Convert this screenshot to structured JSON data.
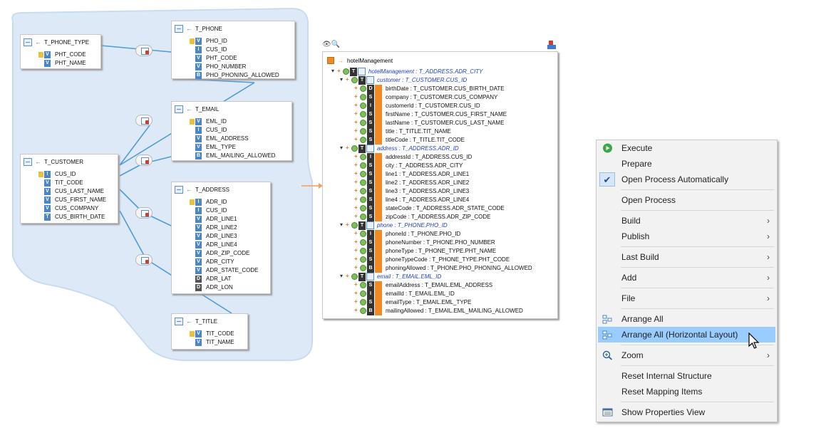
{
  "colors": {
    "diagram_background": "#dde9f7",
    "connector": "#4f9bd6",
    "mapping_arrow": "#f0a060",
    "menu_selection": "#99ccff",
    "menu_background": "#f2f2f2"
  },
  "tables": [
    {
      "name": "T_PHONE_TYPE",
      "columns": [
        {
          "name": "PHT_CODE",
          "type": "V",
          "key": true
        },
        {
          "name": "PHT_NAME",
          "type": "V",
          "key": false
        }
      ]
    },
    {
      "name": "T_PHONE",
      "columns": [
        {
          "name": "PHO_ID",
          "type": "V",
          "key": true
        },
        {
          "name": "CUS_ID",
          "type": "I",
          "key": false
        },
        {
          "name": "PHT_CODE",
          "type": "V",
          "key": false
        },
        {
          "name": "PHO_NUMBER",
          "type": "V",
          "key": false
        },
        {
          "name": "PHO_PHONING_ALLOWED",
          "type": "B",
          "key": false
        }
      ]
    },
    {
      "name": "T_EMAIL",
      "columns": [
        {
          "name": "EML_ID",
          "type": "V",
          "key": true
        },
        {
          "name": "CUS_ID",
          "type": "I",
          "key": false
        },
        {
          "name": "EML_ADDRESS",
          "type": "V",
          "key": false
        },
        {
          "name": "EML_TYPE",
          "type": "V",
          "key": false
        },
        {
          "name": "EML_MAILING_ALLOWED",
          "type": "B",
          "key": false
        }
      ]
    },
    {
      "name": "T_CUSTOMER",
      "columns": [
        {
          "name": "CUS_ID",
          "type": "I",
          "key": true
        },
        {
          "name": "TIT_CODE",
          "type": "V",
          "key": false
        },
        {
          "name": "CUS_LAST_NAME",
          "type": "V",
          "key": false
        },
        {
          "name": "CUS_FIRST_NAME",
          "type": "V",
          "key": false
        },
        {
          "name": "CUS_COMPANY",
          "type": "V",
          "key": false
        },
        {
          "name": "CUS_BIRTH_DATE",
          "type": "T",
          "key": false
        }
      ]
    },
    {
      "name": "T_ADDRESS",
      "columns": [
        {
          "name": "ADR_ID",
          "type": "I",
          "key": true
        },
        {
          "name": "CUS_ID",
          "type": "I",
          "key": false
        },
        {
          "name": "ADR_LINE1",
          "type": "V",
          "key": false
        },
        {
          "name": "ADR_LINE2",
          "type": "V",
          "key": false
        },
        {
          "name": "ADR_LINE3",
          "type": "V",
          "key": false
        },
        {
          "name": "ADR_LINE4",
          "type": "V",
          "key": false
        },
        {
          "name": "ADR_ZIP_CODE",
          "type": "V",
          "key": false
        },
        {
          "name": "ADR_CITY",
          "type": "V",
          "key": false
        },
        {
          "name": "ADR_STATE_CODE",
          "type": "V",
          "key": false
        },
        {
          "name": "ADR_LAT",
          "type": "D",
          "key": false
        },
        {
          "name": "ADR_LON",
          "type": "D",
          "key": false
        }
      ]
    },
    {
      "name": "T_TITLE",
      "columns": [
        {
          "name": "TIT_CODE",
          "type": "V",
          "key": true
        },
        {
          "name": "TIT_NAME",
          "type": "V",
          "key": false
        }
      ]
    }
  ],
  "tree": {
    "root": "hotelManagement",
    "nodes": [
      {
        "text": "hotelManagement : T_ADDRESS.ADR_CITY",
        "icon": "T",
        "group": true
      },
      {
        "text": "customer : T_CUSTOMER.CUS_ID",
        "icon": "T",
        "group": true
      },
      {
        "text": "birthDate : T_CUSTOMER.CUS_BIRTH_DATE",
        "icon": "D",
        "group": false
      },
      {
        "text": "company : T_CUSTOMER.CUS_COMPANY",
        "icon": "S",
        "group": false
      },
      {
        "text": "customerId : T_CUSTOMER.CUS_ID",
        "icon": "I",
        "group": false
      },
      {
        "text": "firstName : T_CUSTOMER.CUS_FIRST_NAME",
        "icon": "S",
        "group": false
      },
      {
        "text": "lastName : T_CUSTOMER.CUS_LAST_NAME",
        "icon": "S",
        "group": false
      },
      {
        "text": "title : T_TITLE.TIT_NAME",
        "icon": "S",
        "group": false
      },
      {
        "text": "titleCode : T_TITLE.TIT_CODE",
        "icon": "S",
        "group": false
      },
      {
        "text": "address : T_ADDRESS.ADR_ID",
        "icon": "T",
        "group": true
      },
      {
        "text": "addressId : T_ADDRESS.CUS_ID",
        "icon": "I",
        "group": false
      },
      {
        "text": "city : T_ADDRESS.ADR_CITY",
        "icon": "S",
        "group": false
      },
      {
        "text": "line1 : T_ADDRESS.ADR_LINE1",
        "icon": "S",
        "group": false
      },
      {
        "text": "line2 : T_ADDRESS.ADR_LINE2",
        "icon": "S",
        "group": false
      },
      {
        "text": "line3 : T_ADDRESS.ADR_LINE3",
        "icon": "S",
        "group": false
      },
      {
        "text": "line4 : T_ADDRESS.ADR_LINE4",
        "icon": "S",
        "group": false
      },
      {
        "text": "stateCode : T_ADDRESS.ADR_STATE_CODE",
        "icon": "S",
        "group": false
      },
      {
        "text": "zipCode : T_ADDRESS.ADR_ZIP_CODE",
        "icon": "S",
        "group": false
      },
      {
        "text": "phone : T_PHONE.PHO_ID",
        "icon": "T",
        "group": true
      },
      {
        "text": "phoneId : T_PHONE.PHO_ID",
        "icon": "I",
        "group": false
      },
      {
        "text": "phoneNumber : T_PHONE.PHO_NUMBER",
        "icon": "S",
        "group": false
      },
      {
        "text": "phoneType : T_PHONE_TYPE.PHT_NAME",
        "icon": "S",
        "group": false
      },
      {
        "text": "phoneTypeCode : T_PHONE_TYPE.PHT_CODE",
        "icon": "S",
        "group": false
      },
      {
        "text": "phoningAllowed : T_PHONE.PHO_PHONING_ALLOWED",
        "icon": "B",
        "group": false
      },
      {
        "text": "email : T_EMAIL.EML_ID",
        "icon": "T",
        "group": true
      },
      {
        "text": "emailAddress : T_EMAIL.EML_ADDRESS",
        "icon": "S",
        "group": false
      },
      {
        "text": "emailId : T_EMAIL.EML_ID",
        "icon": "I",
        "group": false
      },
      {
        "text": "emailType : T_EMAIL.EML_TYPE",
        "icon": "S",
        "group": false
      },
      {
        "text": "mailingAllowed : T_EMAIL.EML_MAILING_ALLOWED",
        "icon": "B",
        "group": false
      }
    ]
  },
  "menu": {
    "items": [
      {
        "label": "Execute",
        "icon": "play-icon",
        "submenu": false
      },
      {
        "label": "Prepare",
        "icon": "",
        "submenu": false
      },
      {
        "label": "Open Process Automatically",
        "icon": "checkmark-icon",
        "submenu": false,
        "checked": true
      },
      {
        "label": "Open Process",
        "icon": "",
        "submenu": false
      },
      {
        "label": "Build",
        "icon": "",
        "submenu": true
      },
      {
        "label": "Publish",
        "icon": "",
        "submenu": true
      },
      {
        "label": "Last Build",
        "icon": "",
        "submenu": true
      },
      {
        "label": "Add",
        "icon": "",
        "submenu": true
      },
      {
        "label": "File",
        "icon": "",
        "submenu": true
      },
      {
        "label": "Arrange All",
        "icon": "arrange-icon",
        "submenu": false
      },
      {
        "label": "Arrange All (Horizontal Layout)",
        "icon": "arrange-icon",
        "submenu": false,
        "highlighted": true
      },
      {
        "label": "Zoom",
        "icon": "zoom-icon",
        "submenu": true
      },
      {
        "label": "Reset Internal Structure",
        "icon": "",
        "submenu": false
      },
      {
        "label": "Reset Mapping Items",
        "icon": "",
        "submenu": false
      },
      {
        "label": "Show Properties View",
        "icon": "properties-icon",
        "submenu": false
      }
    ]
  }
}
